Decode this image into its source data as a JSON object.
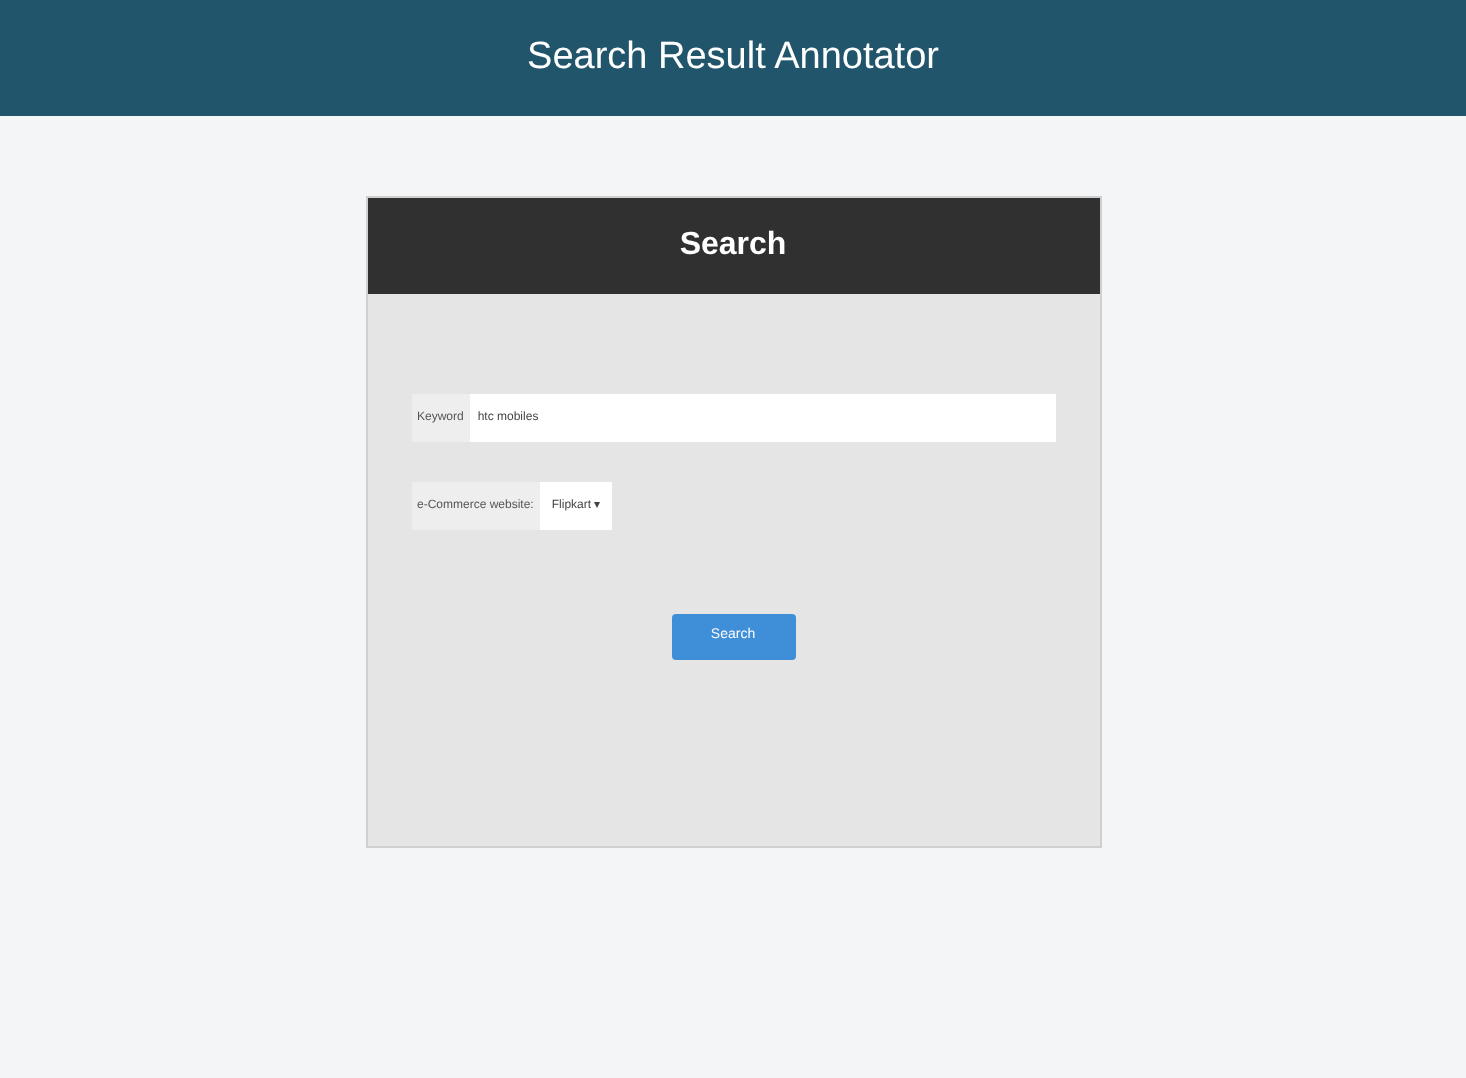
{
  "header": {
    "title": "Search Result Annotator"
  },
  "card": {
    "title": "Search",
    "keyword": {
      "label": "Keyword",
      "value": "htc mobiles"
    },
    "website": {
      "label": "e-Commerce website:",
      "value": "Flipkart",
      "arrow": "▾"
    },
    "button": "Search"
  }
}
